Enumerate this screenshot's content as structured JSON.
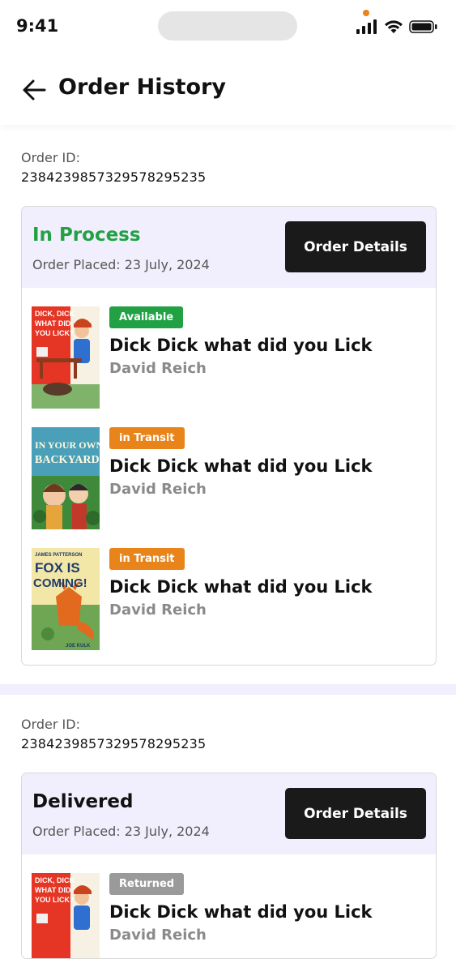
{
  "status_bar": {
    "time": "9:41"
  },
  "header": {
    "title": "Order History"
  },
  "orders": [
    {
      "id_label": "Order ID:",
      "id_value": "23842398573295782952​35",
      "status": "In Process",
      "status_color": "#22a144",
      "placed": "Order Placed: 23 July, 2024",
      "details_label": "Order Details",
      "items": [
        {
          "badge": "Available",
          "badge_color": "#22a144",
          "title": "Dick Dick what did you Lick",
          "author": "David Reich",
          "cover": "dick-dick-cover",
          "cover_text": [
            "DICK, DICK",
            "WHAT DID",
            "YOU LICK?"
          ]
        },
        {
          "badge": "in Transit",
          "badge_color": "#e8841a",
          "title": "Dick Dick what did you Lick",
          "author": "David Reich",
          "cover": "backyard-cover",
          "cover_text": [
            "IN YOUR OWN",
            "BACKYARD"
          ]
        },
        {
          "badge": "in Transit",
          "badge_color": "#e8841a",
          "title": "Dick Dick what did you Lick",
          "author": "David Reich",
          "cover": "fox-cover",
          "cover_text": [
            "JAMES PATTERSON",
            "FOX IS",
            "COMING!",
            "JOE KULK"
          ]
        }
      ]
    },
    {
      "id_label": "Order ID:",
      "id_value": "23842398573295782952​35",
      "status": "Delivered",
      "status_color": "#111111",
      "placed": "Order Placed: 23 July, 2024",
      "details_label": "Order Details",
      "items": [
        {
          "badge": "Returned",
          "badge_color": "#9a9a9a",
          "title": "Dick Dick what did you Lick",
          "author": "David Reich",
          "cover": "dick-dick-cover",
          "cover_text": [
            "DICK, DICK",
            "WHAT DID",
            "YOU LICK?"
          ]
        }
      ]
    }
  ]
}
